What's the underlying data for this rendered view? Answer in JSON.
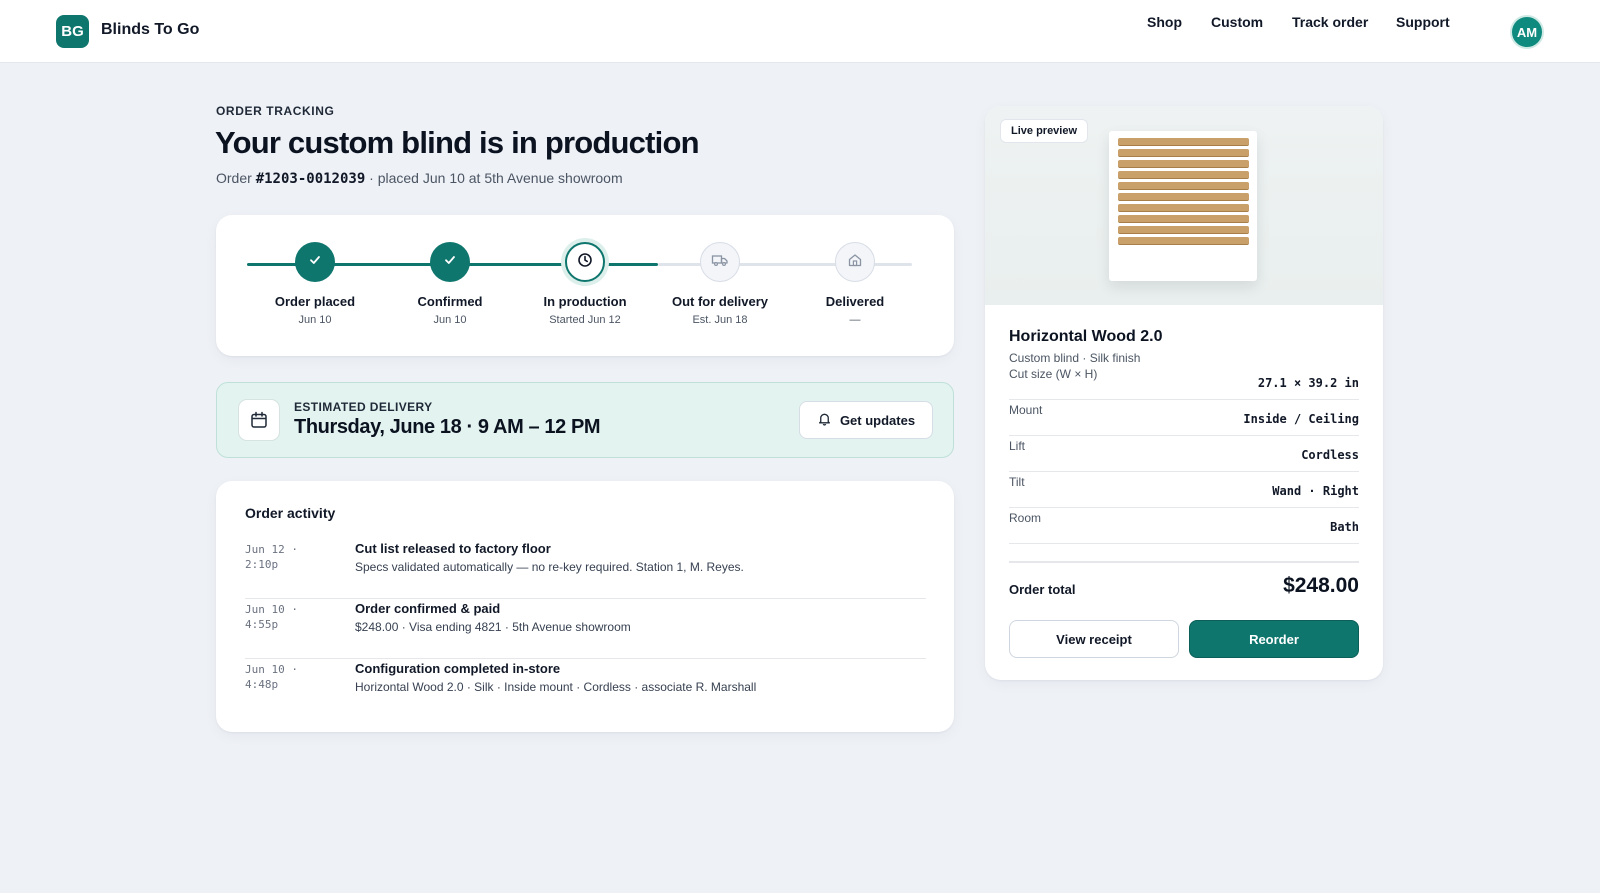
{
  "header": {
    "logo_initials": "BG",
    "brand": "Blinds To Go",
    "nav": [
      "Shop",
      "Custom",
      "Track order",
      "Support"
    ],
    "avatar_initials": "AM"
  },
  "order": {
    "eyebrow": "ORDER TRACKING",
    "title": "Your custom blind is in production",
    "prefix": "Order",
    "number": "#1203-0012039",
    "suffix": " · placed Jun 10 at 5th Avenue showroom"
  },
  "progress": {
    "steps": [
      {
        "label": "Order placed",
        "sub": "Jun 10",
        "status": "done",
        "icon": "check-icon"
      },
      {
        "label": "Confirmed",
        "sub": "Jun 10",
        "status": "done",
        "icon": "check-icon"
      },
      {
        "label": "In production",
        "sub": "Started Jun 12",
        "status": "current",
        "icon": "clock-icon"
      },
      {
        "label": "Out for delivery",
        "sub": "Est. Jun 18",
        "status": "todo",
        "icon": "truck-icon"
      },
      {
        "label": "Delivered",
        "sub": "—",
        "status": "todo",
        "icon": "home-icon"
      }
    ]
  },
  "delivery": {
    "eyebrow": "ESTIMATED DELIVERY",
    "date": "Thursday, June 18 · 9 AM – 12 PM",
    "button": "Get updates"
  },
  "activity": {
    "title": "Order activity",
    "items": [
      {
        "date": "Jun 12 ·",
        "time": "2:10p",
        "title": "Cut list released to factory floor",
        "desc": "Specs validated automatically — no re-key required. Station 1, M. Reyes."
      },
      {
        "date": "Jun 10 ·",
        "time": "4:55p",
        "title": "Order confirmed & paid",
        "desc": "$248.00 · Visa ending 4821 · 5th Avenue showroom"
      },
      {
        "date": "Jun 10 ·",
        "time": "4:48p",
        "title": "Configuration completed in-store",
        "desc": "Horizontal Wood 2.0 · Silk · Inside mount · Cordless · associate R. Marshall"
      }
    ]
  },
  "product": {
    "preview_label": "Live preview",
    "name": "Horizontal Wood 2.0",
    "subtitle": "Custom blind · Silk finish",
    "specs": [
      {
        "label": "Cut size (W × H)",
        "value": "27.1 × 39.2 in"
      },
      {
        "label": "Mount",
        "value": "Inside / Ceiling"
      },
      {
        "label": "Lift",
        "value": "Cordless"
      },
      {
        "label": "Tilt",
        "value": "Wand · Right"
      },
      {
        "label": "Room",
        "value": "Bath"
      }
    ],
    "total_label": "Order total",
    "total_value": "$248.00",
    "receipt_button": "View receipt",
    "reorder_button": "Reorder"
  },
  "colors": {
    "accent": "#0f766e",
    "page_bg": "#eef1f6",
    "delivery_bg": "#e3f3ef",
    "slat": "#c9a06a"
  }
}
